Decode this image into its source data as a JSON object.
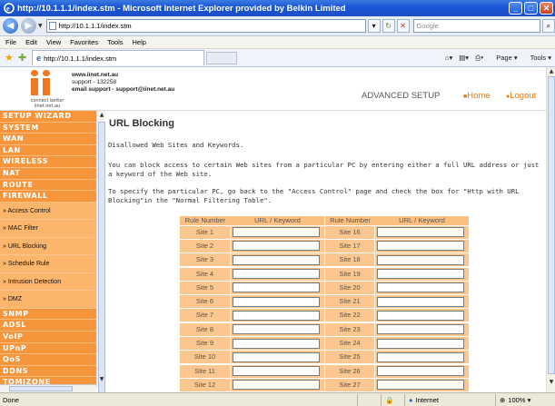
{
  "window": {
    "title": "http://10.1.1.1/index.stm - Microsoft Internet Explorer provided by Belkin Limited",
    "min": "_",
    "max": "□",
    "close": "✕"
  },
  "address": {
    "url": "http://10.1.1.1/index.stm",
    "search_placeholder": "Google"
  },
  "menu": [
    "File",
    "Edit",
    "View",
    "Favorites",
    "Tools",
    "Help"
  ],
  "tab": {
    "label": "http://10.1.1.1/index.stm"
  },
  "commands": {
    "page": "Page",
    "tools": "Tools"
  },
  "header": {
    "website": "www.iinet.net.au",
    "support": "support - 132258",
    "email": "email support - support@iinet.net.au",
    "tagline1": "connect better",
    "tagline2": "iinet.net.au",
    "advanced_setup": "ADVANCED SETUP",
    "home": "Home",
    "logout": "Logout"
  },
  "sidebar": {
    "items": [
      {
        "label": "SETUP WIZARD",
        "sub": false
      },
      {
        "label": "SYSTEM",
        "sub": false
      },
      {
        "label": "WAN",
        "sub": false
      },
      {
        "label": "LAN",
        "sub": false
      },
      {
        "label": "WIRELESS",
        "sub": false
      },
      {
        "label": "NAT",
        "sub": false
      },
      {
        "label": "ROUTE",
        "sub": false
      },
      {
        "label": "FIREWALL",
        "sub": false
      },
      {
        "label": "» Access Control",
        "sub": true
      },
      {
        "label": "» MAC Filter",
        "sub": true
      },
      {
        "label": "» URL Blocking",
        "sub": true
      },
      {
        "label": "» Schedule Rule",
        "sub": true
      },
      {
        "label": "» Intrusion Detection",
        "sub": true
      },
      {
        "label": "» DMZ",
        "sub": true
      },
      {
        "label": "SNMP",
        "sub": false
      },
      {
        "label": "ADSL",
        "sub": false
      },
      {
        "label": "VoIP",
        "sub": false
      },
      {
        "label": "UPnP",
        "sub": false
      },
      {
        "label": "QoS",
        "sub": false
      },
      {
        "label": "DDNS",
        "sub": false
      },
      {
        "label": "TOMIZONE",
        "sub": false
      }
    ]
  },
  "content": {
    "title": "URL Blocking",
    "p1": "Disallowed Web Sites and Keywords.",
    "p2": "You can block access to certain Web sites from a particular PC by entering either a full URL address or just a keyword of the Web site.",
    "p3": "To specify the particular PC, go back to the \"Access Control\" page and check the box for \"Http with URL Blocking\"in the \"Normal Filtering Table\".",
    "col_rule": "Rule Number",
    "col_url": "URL / Keyword",
    "left_rules": [
      "Site  1",
      "Site  2",
      "Site  3",
      "Site  4",
      "Site  5",
      "Site  6",
      "Site  7",
      "Site  8",
      "Site  9",
      "Site  10",
      "Site  11",
      "Site  12"
    ],
    "right_rules": [
      "Site  16",
      "Site  17",
      "Site  18",
      "Site  19",
      "Site  20",
      "Site  21",
      "Site  22",
      "Site  23",
      "Site  24",
      "Site  25",
      "Site  26",
      "Site  27"
    ]
  },
  "status": {
    "left": "Done",
    "zone": "Internet",
    "zoom": "100%"
  },
  "colors": {
    "accent_orange": "#f7953c",
    "link_orange": "#f07800",
    "title_blue": "#1955d6"
  }
}
